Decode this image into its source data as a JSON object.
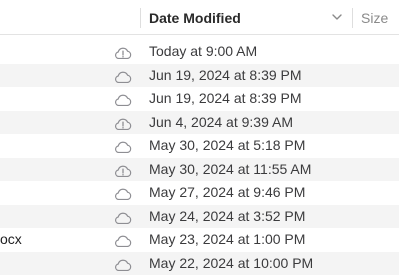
{
  "header": {
    "date_modified": "Date Modified",
    "size": "Size"
  },
  "rows": [
    {
      "name": "",
      "date": "Today at 9:00 AM",
      "cloud": "cloud-alert-icon"
    },
    {
      "name": "",
      "date": "Jun 19, 2024 at 8:39 PM",
      "cloud": "cloud-icon"
    },
    {
      "name": "",
      "date": "Jun 19, 2024 at 8:39 PM",
      "cloud": "cloud-icon"
    },
    {
      "name": "",
      "date": "Jun 4, 2024 at 9:39 AM",
      "cloud": "cloud-alert-icon"
    },
    {
      "name": "",
      "date": "May 30, 2024 at 5:18 PM",
      "cloud": "cloud-icon"
    },
    {
      "name": "",
      "date": "May 30, 2024 at 11:55 AM",
      "cloud": "cloud-alert-icon"
    },
    {
      "name": "",
      "date": "May 27, 2024 at 9:46 PM",
      "cloud": "cloud-icon"
    },
    {
      "name": "",
      "date": "May 24, 2024 at 3:52 PM",
      "cloud": "cloud-icon"
    },
    {
      "name": "ocx",
      "date": "May 23, 2024 at 1:00 PM",
      "cloud": "cloud-icon"
    },
    {
      "name": "",
      "date": "May 22, 2024 at 10:00 PM",
      "cloud": "cloud-icon"
    }
  ],
  "colors": {
    "header_border": "#e3e3e3",
    "alt_row": "#f4f4f4",
    "text": "#3b3b3d",
    "icon": "#8e8e93"
  }
}
